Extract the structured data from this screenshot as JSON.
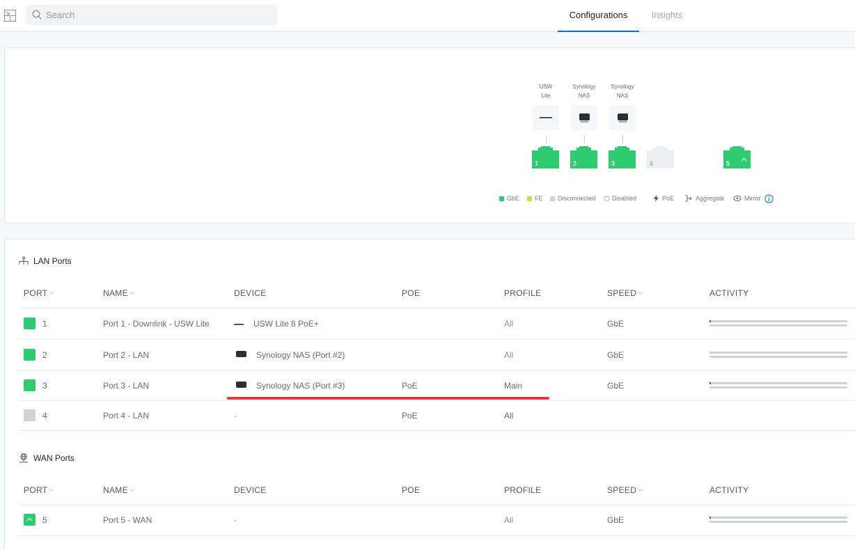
{
  "search": {
    "placeholder": "Search"
  },
  "tabs": [
    {
      "label": "Configurations",
      "active": true
    },
    {
      "label": "Insights",
      "active": false
    }
  ],
  "diagram": {
    "devices": [
      {
        "label_top": "USW",
        "label_bottom": "Lite",
        "icon": "switch-icon"
      },
      {
        "label_top": "Synology",
        "label_bottom": "NAS",
        "icon": "nas-icon"
      },
      {
        "label_top": "Synology",
        "label_bottom": "NAS",
        "icon": "nas-icon"
      }
    ],
    "ports": [
      "1",
      "2",
      "3",
      "4",
      "5"
    ],
    "legend": {
      "gbe": "GbE",
      "fe": "FE",
      "disconnected": "Disconnected",
      "disabled": "Disabled",
      "poe": "PoE",
      "aggregate": "Aggregate",
      "mirror": "Mirror"
    },
    "colors": {
      "gbe": "#2ecc71",
      "fe": "#c8dd4a",
      "disconnected": "#cfd3d8",
      "disabled": "#ffffff"
    }
  },
  "lan": {
    "title": "LAN Ports",
    "headers": {
      "port": "PORT",
      "name": "NAME",
      "device": "DEVICE",
      "poe": "POE",
      "profile": "PROFILE",
      "speed": "SPEED",
      "activity": "ACTIVITY"
    },
    "rows": [
      {
        "port": "1",
        "name": "Port 1 - Downlink - USW Lite",
        "device": "USW Lite 8 PoE+",
        "poe": "",
        "profile": "All",
        "speed": "GbE"
      },
      {
        "port": "2",
        "name": "Port 2 - LAN",
        "device": "Synology NAS (Port #2)",
        "poe": "",
        "profile": "All",
        "speed": "GbE"
      },
      {
        "port": "3",
        "name": "Port 3 - LAN",
        "device": "Synology NAS (Port #3)",
        "poe": "PoE",
        "profile": "Main",
        "speed": "GbE"
      },
      {
        "port": "4",
        "name": "Port 4 - LAN",
        "device": "-",
        "poe": "PoE",
        "profile": "All",
        "speed": ""
      }
    ]
  },
  "wan": {
    "title": "WAN Ports",
    "headers": {
      "port": "PORT",
      "name": "NAME",
      "device": "DEVICE",
      "poe": "POE",
      "profile": "PROFILE",
      "speed": "SPEED",
      "activity": "ACTIVITY"
    },
    "rows": [
      {
        "port": "5",
        "name": "Port 5 - WAN",
        "device": "-",
        "poe": "",
        "profile": "All",
        "speed": "GbE"
      }
    ]
  }
}
